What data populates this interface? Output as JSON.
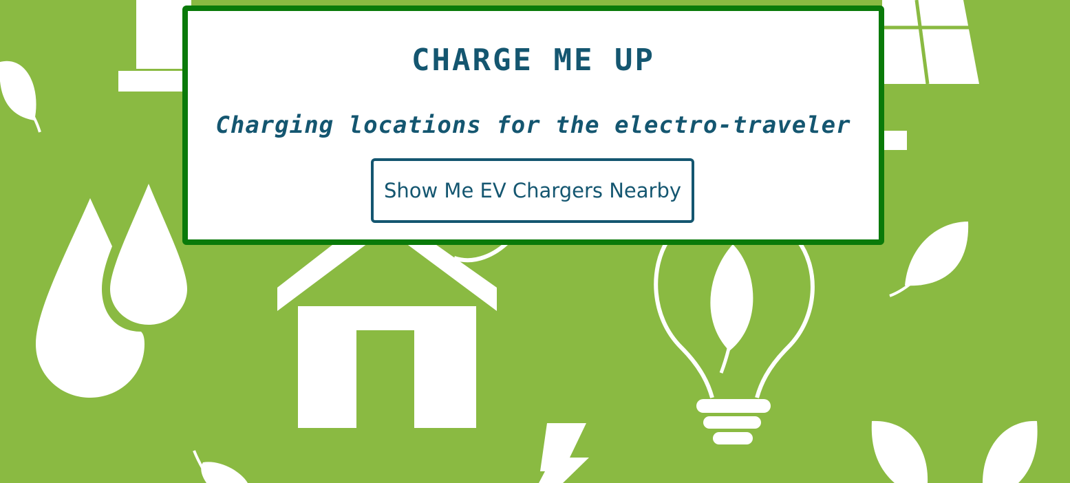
{
  "colors": {
    "background": "#8aba42",
    "card_border": "#0a7a0a",
    "text": "#145670",
    "icons": "#ffffff"
  },
  "hero": {
    "title": "CHARGE ME UP",
    "tagline": "Charging locations for the electro-traveler",
    "cta_label": "Show Me EV Chargers Nearby"
  },
  "background_icons": [
    "factory-icon",
    "solar-panel-icon",
    "leaf-icon",
    "water-drops-icon",
    "house-icon",
    "lightbulb-leaf-icon",
    "lightning-bolt-icon",
    "sprout-icon"
  ]
}
